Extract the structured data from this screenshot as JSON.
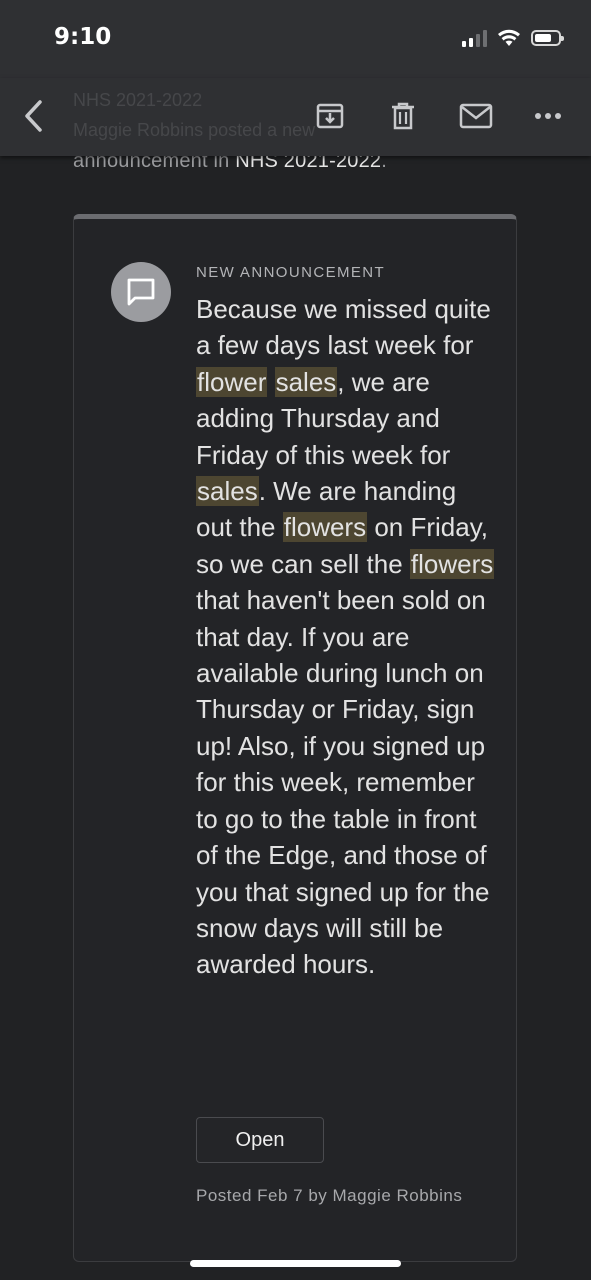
{
  "status_bar": {
    "time": "9:10"
  },
  "toolbar": {
    "ghost_title": "NHS 2021-2022",
    "ghost_sub": "Maggie Robbins posted a new"
  },
  "email": {
    "subject_prefix": "announcement in ",
    "subject_highlight": "NHS 2021-2022",
    "subject_suffix": "."
  },
  "card": {
    "kicker": "NEW ANNOUNCEMENT",
    "body": [
      "Because we missed quite a few days last week for ",
      "flower",
      " ",
      "sales",
      ", we are adding Thursday and Friday of this week for ",
      "sales",
      ". We are handing out the ",
      "flowers",
      " on Friday, so we can sell the ",
      "flowers",
      " that haven't been sold on that day. If you are available during lunch on Thursday or Friday, sign up! Also, if you signed up for this week, remember to go to the table in front of the Edge, and those of you that signed up for the snow days will still be awarded hours."
    ],
    "open_label": "Open",
    "posted": "Posted Feb 7 by Maggie Robbins"
  },
  "colors": {
    "background": "#212224",
    "bar": "#2f3033",
    "highlight": "#4d4631"
  },
  "icons": [
    "back-icon",
    "archive-icon",
    "trash-icon",
    "mail-icon",
    "more-icon",
    "announcement-icon"
  ]
}
